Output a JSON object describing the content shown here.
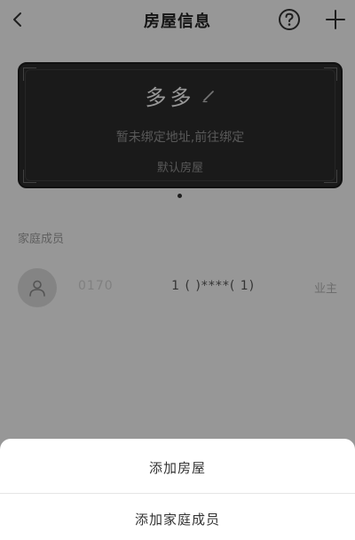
{
  "header": {
    "title": "房屋信息",
    "back_icon": "chevron-left-icon",
    "help_icon": "question-circle-icon",
    "add_icon": "plus-icon"
  },
  "house_card": {
    "name": "多多",
    "edit_icon": "pencil-icon",
    "address_prompt": "暂未绑定地址,前往绑定",
    "default_label": "默认房屋"
  },
  "family": {
    "section_title": "家庭成员",
    "members": [
      {
        "name": "0170",
        "phone_masked": "1 (  )****(  1)",
        "role": "业主",
        "avatar_icon": "user-icon"
      }
    ]
  },
  "action_sheet": {
    "items": [
      {
        "label": "添加房屋"
      },
      {
        "label": "添加家庭成员"
      }
    ]
  },
  "colors": {
    "card_background": "#2a2a2a",
    "overlay": "#000000",
    "sheet_background": "#ffffff"
  }
}
